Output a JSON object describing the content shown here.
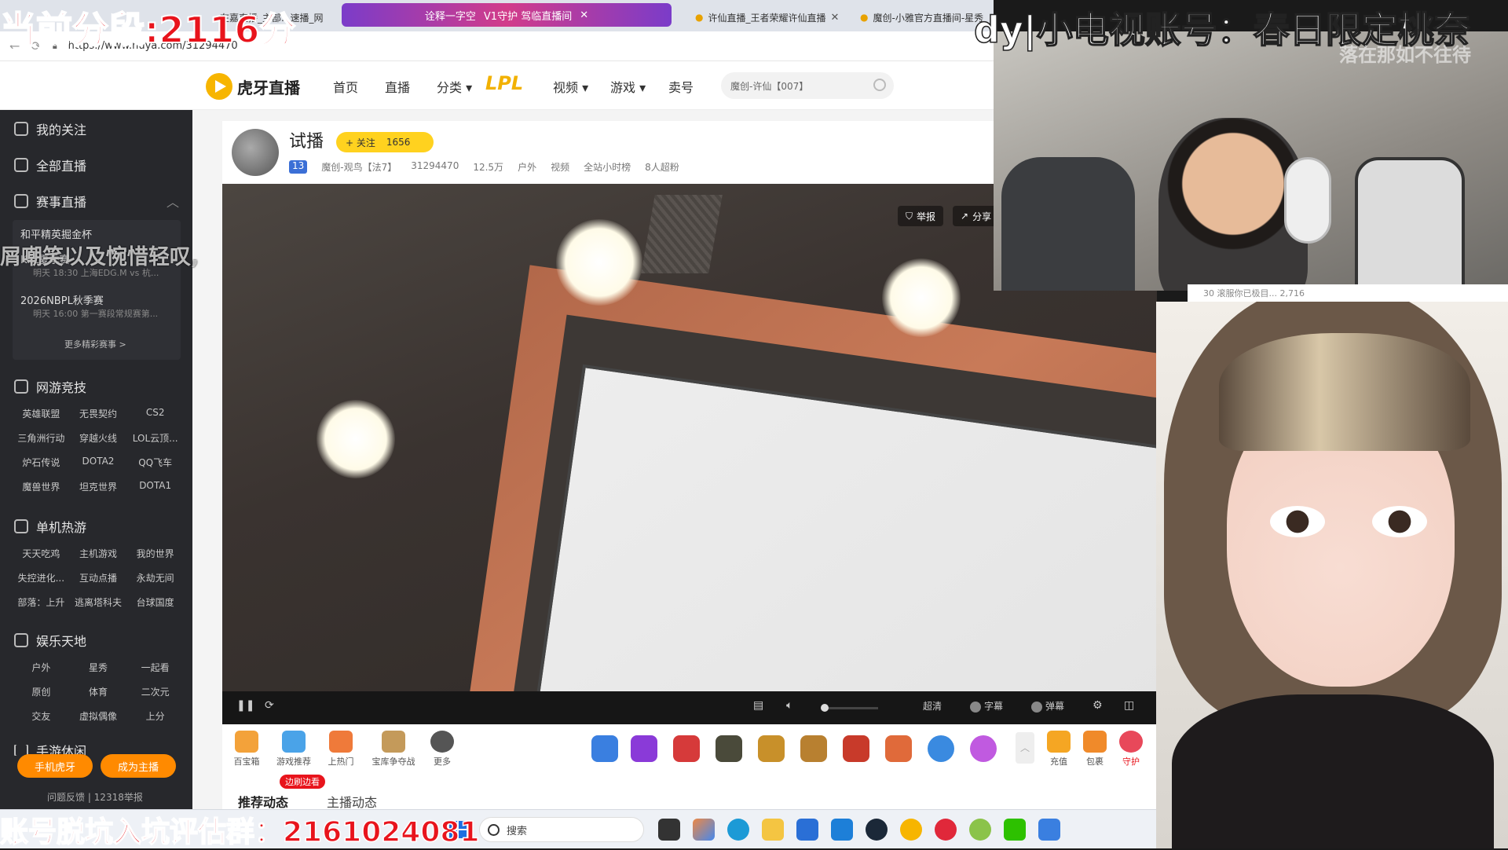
{
  "overlays": {
    "segment": "当前分段:2116分",
    "dy": "dy|小电视账号：春日限定桃奈",
    "dy_sub": "落在那如不往待",
    "scroll_text": "屑嘲笑以及惋惜轻叹,",
    "bottom": "账号脱坑入坑评估群：2161024081"
  },
  "browser": {
    "tabs": [
      "在嘉直播_主部...速播_网",
      "许仙直播_王者荣耀许仙直播",
      "魔创-小雅官方直播间-星秀"
    ],
    "promo_tab": {
      "label": "诠释一字空",
      "sub": "V1守护 驾临直播间"
    },
    "url": "https://www.huya.com/31294470"
  },
  "header": {
    "logo_text": "虎牙直播",
    "nav": [
      "首页",
      "直播",
      "分类",
      "LPL",
      "视频",
      "游戏",
      "卖号"
    ],
    "search_placeholder": "魔创-许仙【007】"
  },
  "sidebar": {
    "items": [
      "我的关注",
      "全部直播",
      "赛事直播"
    ],
    "matches": [
      {
        "title": "和平精英掘金杯",
        "sub": ""
      },
      {
        "title": "KPL夏季赛",
        "sub": "明天 18:30 上海EDG.M vs 杭..."
      },
      {
        "title": "2026NBPL秋季赛",
        "sub": "明天 16:00 第一赛段常规赛第..."
      }
    ],
    "more_matches": "更多精彩赛事 >",
    "sections": [
      {
        "title": "网游竞技",
        "items": [
          "英雄联盟",
          "无畏契约",
          "CS2",
          "三角洲行动",
          "穿越火线",
          "LOL云顶...",
          "炉石传说",
          "DOTA2",
          "QQ飞车",
          "魔兽世界",
          "坦克世界",
          "DOTA1"
        ]
      },
      {
        "title": "单机热游",
        "items": [
          "天天吃鸡",
          "主机游戏",
          "我的世界",
          "失控进化...",
          "互动点播",
          "永劫无间",
          "部落：上升",
          "逃离塔科夫",
          "台球国度"
        ]
      },
      {
        "title": "娱乐天地",
        "items": [
          "户外",
          "星秀",
          "一起看",
          "原创",
          "体育",
          "二次元",
          "交友",
          "虚拟偶像",
          "上分"
        ]
      },
      {
        "title": "手游休闲",
        "items": []
      }
    ],
    "btn_mobile": "手机虎牙",
    "btn_anchor": "成为主播",
    "footer": "问题反馈 | 12318举报"
  },
  "room": {
    "title": "试播",
    "follow": "+ 关注",
    "follow_count": "1656",
    "meta": [
      "13",
      "魔创-观鸟【法7】",
      "31294470",
      "12.5万",
      "户外",
      "视频",
      "全站小时榜",
      "8人超粉"
    ],
    "report": "举报",
    "share": "分享"
  },
  "controls": {
    "quality": "超清",
    "subtitle": "字幕",
    "danmaku": "弹幕"
  },
  "gifts": {
    "left": [
      "百宝箱",
      "游戏推荐",
      "上热门",
      "宝库争夺战",
      "更多"
    ],
    "right": [
      "充值",
      "包裹",
      "守护"
    ]
  },
  "tabs": {
    "side_watch": "边刷边看",
    "recommend": "推荐动态",
    "anchor": "主播动态"
  },
  "cam_strip": "30 滚服你已极目...  2,716",
  "taskbar": {
    "search": "搜索"
  },
  "colors": {
    "accent": "#ffd21f",
    "overlay_red": "#e8141c",
    "sidebar": "#27282c"
  }
}
